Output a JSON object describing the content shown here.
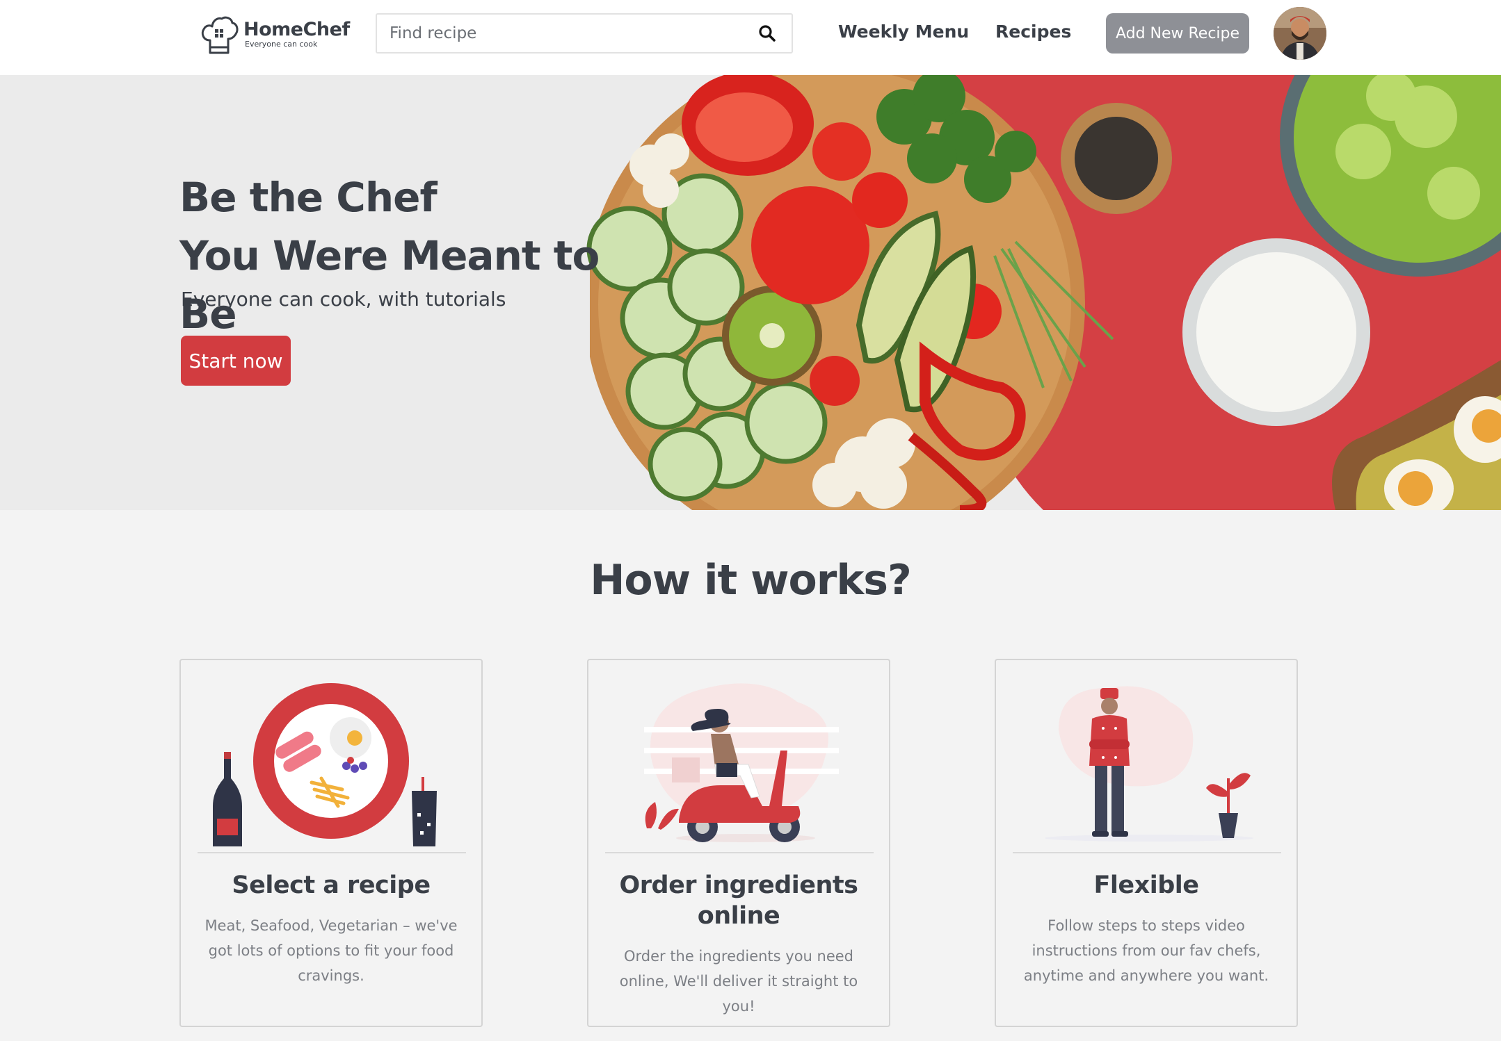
{
  "brand": {
    "name": "HomeChef",
    "tagline": "Everyone can cook"
  },
  "search": {
    "placeholder": "Find recipe",
    "value": ""
  },
  "nav": {
    "weekly_menu": "Weekly Menu",
    "recipes": "Recipes",
    "add_recipe": "Add New Recipe"
  },
  "hero": {
    "title_line1": "Be the Chef",
    "title_line2": "You Were Meant to Be",
    "subtitle": "Everyone can cook, with tutorials",
    "cta": "Start now"
  },
  "how": {
    "title": "How it works?",
    "cards": [
      {
        "title": "Select a recipe",
        "description": "Meat, Seafood, Vegetarian – we've got lots of options to fit your food cravings."
      },
      {
        "title": "Order ingredients online",
        "description": "Order the ingredients you need online, We'll deliver it straight to you!"
      },
      {
        "title": "Flexible",
        "description": "Follow steps to steps video instructions from our fav chefs, anytime and anywhere you want."
      }
    ]
  },
  "icons": {
    "search": "search-icon",
    "logo": "chef-hat-icon"
  },
  "colors": {
    "accent": "#d23c40",
    "text": "#3a3f47",
    "muted": "#7c7f85",
    "button_gray": "#8e9096",
    "hero_bg": "#ebebeb",
    "page_bg": "#f3f3f3"
  }
}
